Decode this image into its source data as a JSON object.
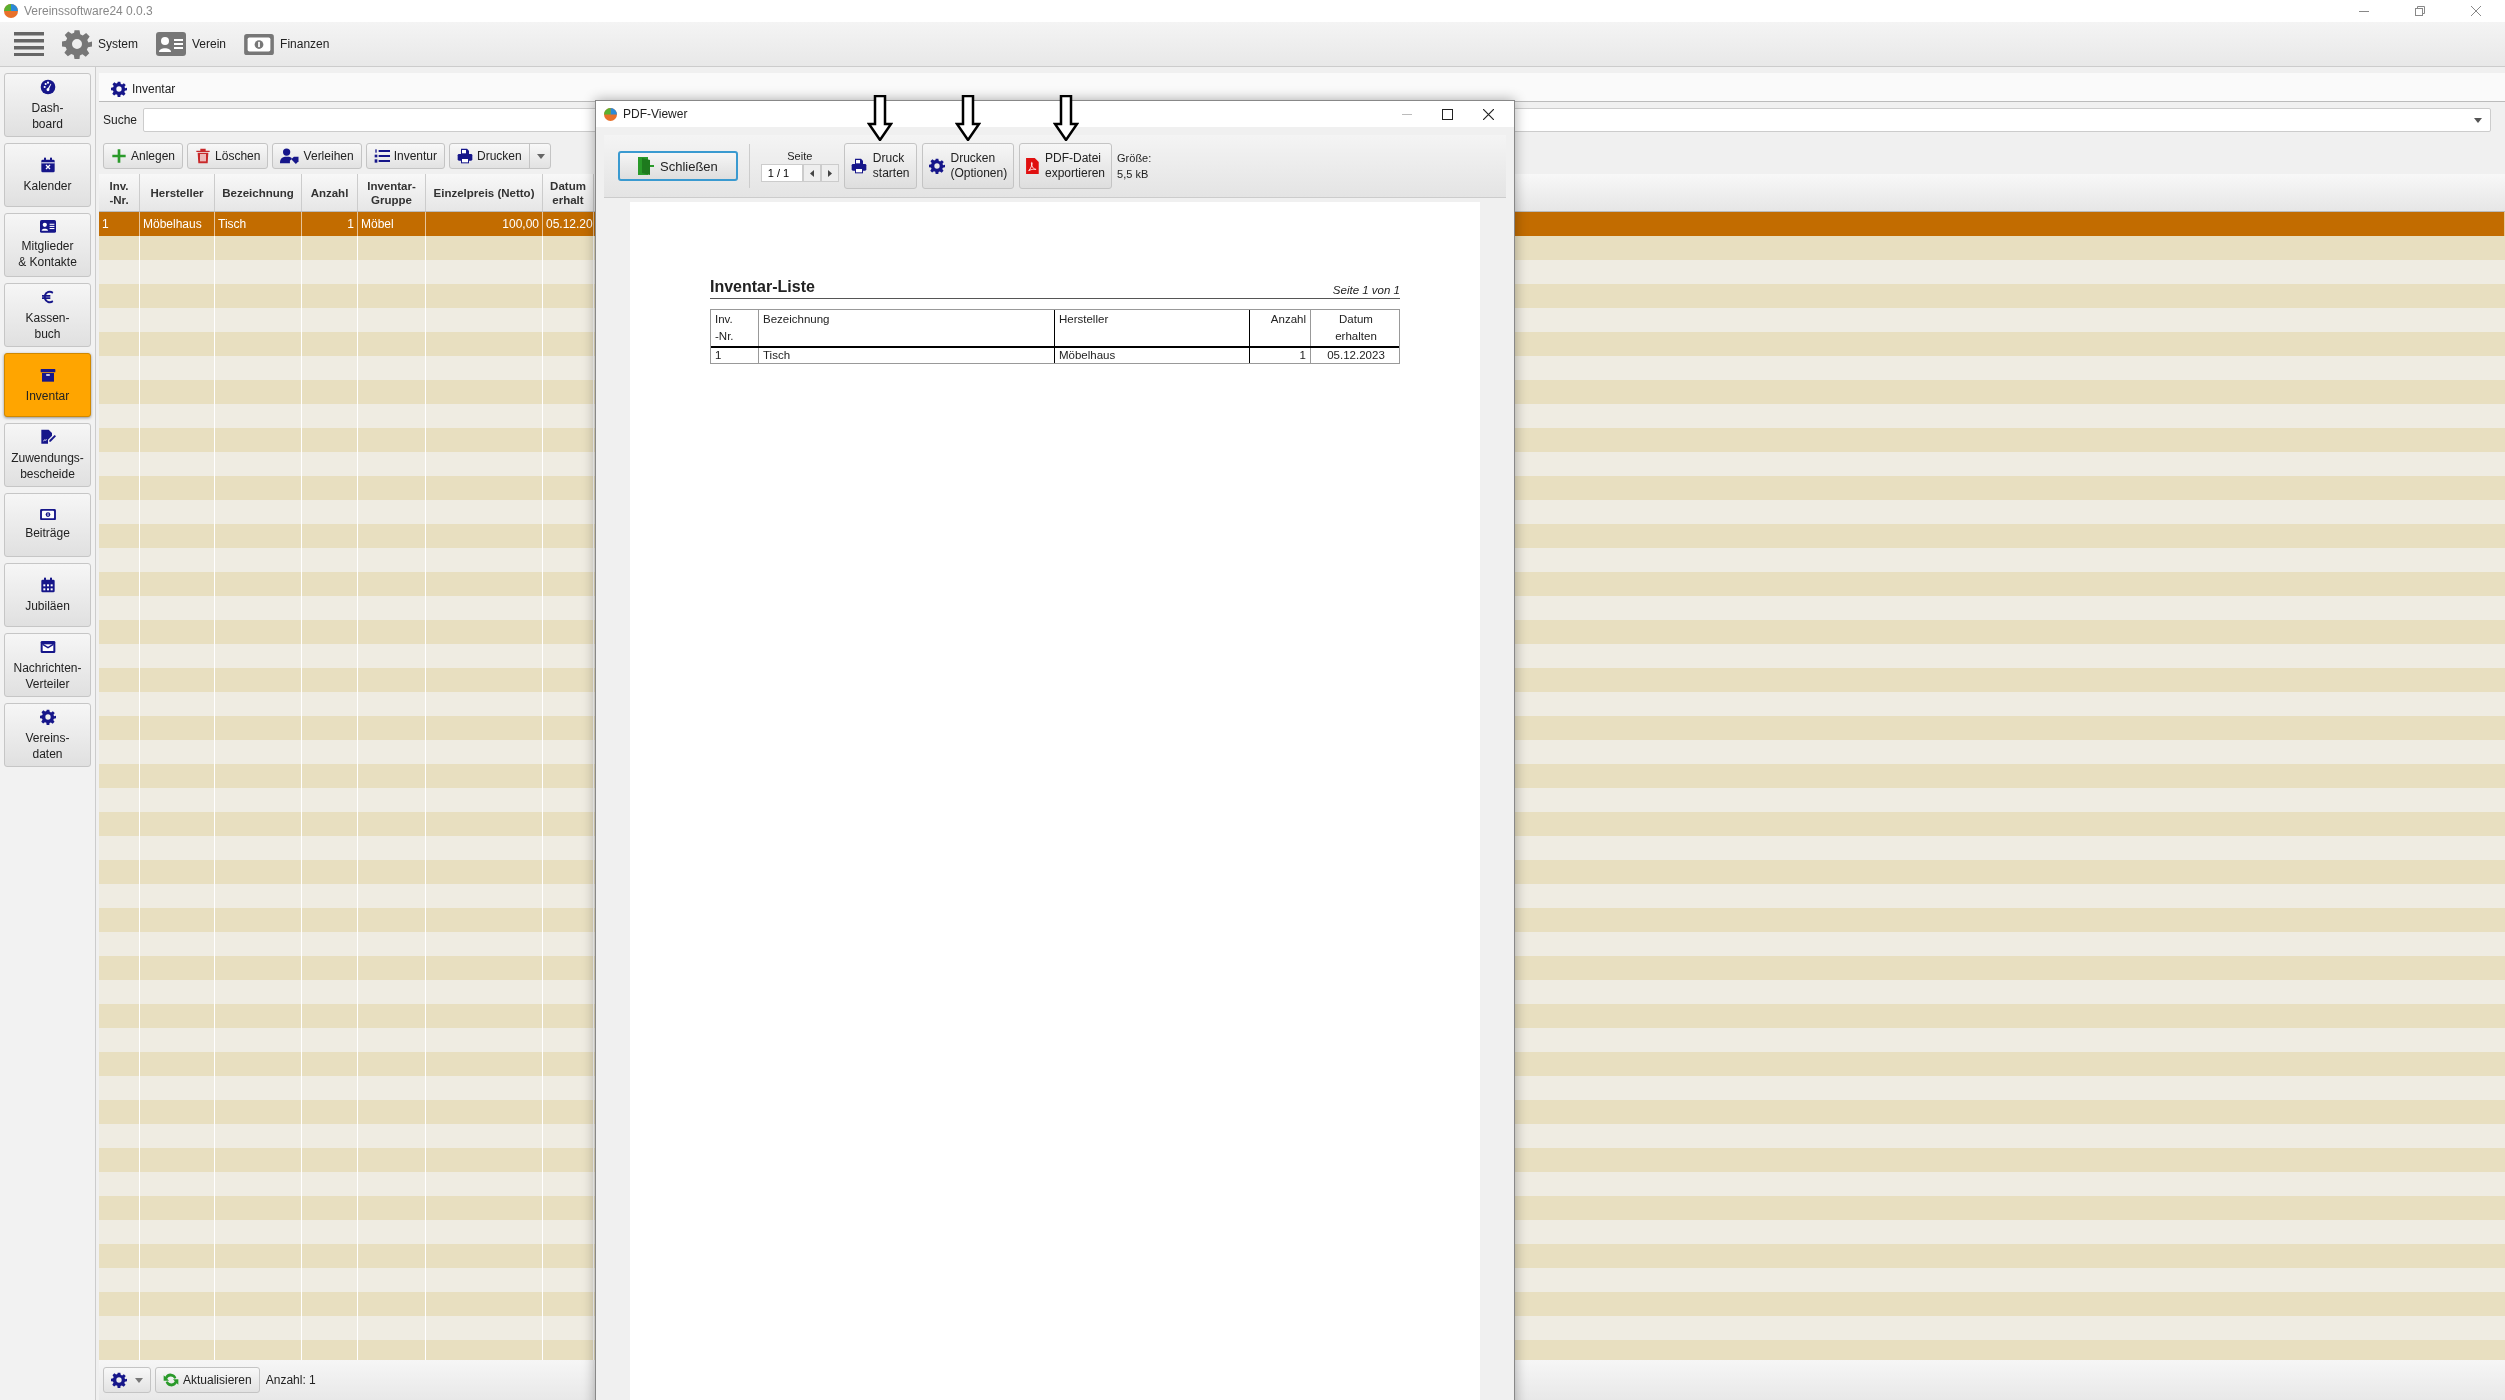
{
  "window": {
    "title": "Vereinssoftware24 0.0.3"
  },
  "menu_bar": [
    {
      "label": "System",
      "kind": "gear"
    },
    {
      "label": "Verein",
      "kind": "card"
    },
    {
      "label": "Finanzen",
      "kind": "money"
    }
  ],
  "sidebar": {
    "items": [
      {
        "lines": [
          "Dash-",
          "board"
        ],
        "kind": "gauge",
        "selected": false
      },
      {
        "lines": [
          "Kalender"
        ],
        "kind": "calendar-x",
        "selected": false
      },
      {
        "lines": [
          "Mitglieder",
          "& Kontakte"
        ],
        "kind": "card",
        "selected": false
      },
      {
        "lines": [
          "Kassen-",
          "buch"
        ],
        "kind": "euro",
        "selected": false
      },
      {
        "lines": [
          "Inventar"
        ],
        "kind": "archive",
        "selected": true
      },
      {
        "lines": [
          "Zuwendungs-",
          "bescheide"
        ],
        "kind": "sign",
        "selected": false
      },
      {
        "lines": [
          "Beiträge"
        ],
        "kind": "money",
        "selected": false
      },
      {
        "lines": [
          "Jubiläen"
        ],
        "kind": "calendar",
        "selected": false
      },
      {
        "lines": [
          "Nachrichten-",
          "Verteiler"
        ],
        "kind": "mail",
        "selected": false
      },
      {
        "lines": [
          "Vereins-",
          "daten"
        ],
        "kind": "gear",
        "selected": false
      }
    ]
  },
  "tab": {
    "label": "Inventar"
  },
  "search": {
    "label": "Suche"
  },
  "toolbar": [
    {
      "label": "Anlegen",
      "kind": "add"
    },
    {
      "label": "Löschen",
      "kind": "delete"
    },
    {
      "label": "Verleihen",
      "kind": "lend"
    },
    {
      "label": "Inventur",
      "kind": "list"
    },
    {
      "label": "Drucken",
      "kind": "print-split"
    }
  ],
  "table": {
    "columns": [
      {
        "lines": [
          "Inv.",
          "-Nr."
        ],
        "kind": "text"
      },
      {
        "lines": [
          "Hersteller"
        ],
        "kind": "text"
      },
      {
        "lines": [
          "Bezeichnung"
        ],
        "kind": "text"
      },
      {
        "lines": [
          "Anzahl"
        ],
        "kind": "number"
      },
      {
        "lines": [
          "Inventar-",
          "Gruppe"
        ],
        "kind": "text"
      },
      {
        "lines": [
          "Einzelpreis (Netto)"
        ],
        "kind": "number"
      },
      {
        "lines": [
          "Datum",
          "erhalt"
        ],
        "kind": "text"
      }
    ],
    "rows": [
      {
        "cells": [
          "1",
          "Möbelhaus",
          "Tisch",
          "1",
          "Möbel",
          "100,00",
          "05.12.20"
        ],
        "selected": true
      }
    ]
  },
  "status_bar": {
    "refresh": "Aktualisieren",
    "count": "Anzahl: 1"
  },
  "pdf_viewer": {
    "title": "PDF-Viewer",
    "close": {
      "label": "Schließen",
      "focused": true
    },
    "page_label": "Seite",
    "page_value": "1 / 1",
    "buttons": [
      {
        "lines": [
          "Druck",
          "starten"
        ],
        "kind": "print",
        "marked": true
      },
      {
        "lines": [
          "Drucken",
          "(Optionen)"
        ],
        "kind": "gear",
        "marked": true
      },
      {
        "lines": [
          "PDF-Datei",
          "exportieren"
        ],
        "kind": "pdf",
        "marked": true
      }
    ],
    "size": [
      "Größe:",
      "5,5 kB"
    ],
    "document": {
      "title": "Inventar-Liste",
      "page": "Seite 1 von 1",
      "columns": [
        {
          "lines": [
            "Inv.",
            "-Nr."
          ],
          "kind": "text"
        },
        {
          "lines": [
            "Bezeichnung"
          ],
          "kind": "text"
        },
        {
          "lines": [
            "Hersteller"
          ],
          "kind": "text"
        },
        {
          "lines": [
            "Anzahl"
          ],
          "kind": "number"
        },
        {
          "lines": [
            "Datum",
            "erhalten"
          ],
          "kind": "center"
        }
      ],
      "rows": [
        [
          "1",
          "Tisch",
          "Möbelhaus",
          "1",
          "05.12.2023"
        ]
      ]
    }
  }
}
